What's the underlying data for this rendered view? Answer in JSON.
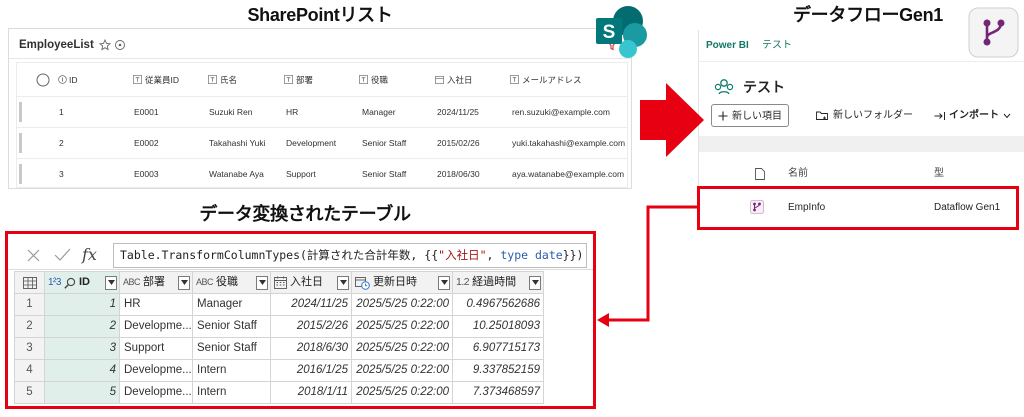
{
  "titles": {
    "sharepoint": "SharePointリスト",
    "dataflow": "データフローGen1",
    "transformed": "データ変換されたテーブル"
  },
  "sharepoint": {
    "logo_letter": "S",
    "list_title": "EmployeeList",
    "columns": [
      "ID",
      "従業員ID",
      "氏名",
      "部署",
      "役職",
      "入社日",
      "メールアドレス"
    ],
    "rows": [
      [
        "1",
        "E0001",
        "Suzuki Ren",
        "HR",
        "Manager",
        "2024/11/25",
        "ren.suzuki@example.com"
      ],
      [
        "2",
        "E0002",
        "Takahashi Yuki",
        "Development",
        "Senior Staff",
        "2015/02/26",
        "yuki.takahashi@example.com"
      ],
      [
        "3",
        "E0003",
        "Watanabe Aya",
        "Support",
        "Senior Staff",
        "2018/06/30",
        "aya.watanabe@example.com"
      ]
    ]
  },
  "dataflow": {
    "app_name": "Power BI",
    "workspace_crumb": "テスト",
    "workspace_title": "テスト",
    "buttons": {
      "new_item": "新しい項目",
      "new_folder": "新しいフォルダー",
      "import": "インポート"
    },
    "columns": {
      "name": "名前",
      "type": "型"
    },
    "row": {
      "name": "EmpInfo",
      "type": "Dataflow Gen1"
    }
  },
  "power_query": {
    "fx_label": "fx",
    "formula": {
      "prefix": "Table.TransformColumnTypes(計算された合計年数, {{",
      "string": "\"入社日\"",
      "sep": ", ",
      "keyword": "type date",
      "suffix": "}})"
    },
    "columns": [
      {
        "type_label": "1²3",
        "name": "ID"
      },
      {
        "type_label": "ABC",
        "name": "部署"
      },
      {
        "type_label": "ABC",
        "name": "役職"
      },
      {
        "name": "入社日"
      },
      {
        "name": "更新日時"
      },
      {
        "type_label": "1.2",
        "name": "経過時間"
      }
    ],
    "rows": [
      {
        "n": "1",
        "id": "1",
        "dept": "HR",
        "role": "Manager",
        "hire": "2024/11/25",
        "updated": "2025/5/25 0:22:00",
        "elapsed": "0.4967562686"
      },
      {
        "n": "2",
        "id": "2",
        "dept": "Developme...",
        "role": "Senior Staff",
        "hire": "2015/2/26",
        "updated": "2025/5/25 0:22:00",
        "elapsed": "10.25018093"
      },
      {
        "n": "3",
        "id": "3",
        "dept": "Support",
        "role": "Senior Staff",
        "hire": "2018/6/30",
        "updated": "2025/5/25 0:22:00",
        "elapsed": "6.907715173"
      },
      {
        "n": "4",
        "id": "4",
        "dept": "Developme...",
        "role": "Intern",
        "hire": "2016/1/25",
        "updated": "2025/5/25 0:22:00",
        "elapsed": "9.337852159"
      },
      {
        "n": "5",
        "id": "5",
        "dept": "Developme...",
        "role": "Intern",
        "hire": "2018/1/11",
        "updated": "2025/5/25 0:22:00",
        "elapsed": "7.373468597"
      }
    ]
  },
  "colors": {
    "highlight_red": "#e60012",
    "powerbi_teal": "#117865",
    "sharepoint_teal": "#03787c",
    "dataflow_purple": "#742774",
    "formula_string": "#a31515",
    "formula_keyword": "#2a5db0",
    "id_column_tint": "#e0efe9"
  },
  "icons": [
    "sharepoint-logo-icon",
    "dataflow-gen1-icon",
    "star-icon",
    "info-circle-icon",
    "filter-icon",
    "select-all-circle-icon",
    "workspace-icon",
    "plus-icon",
    "folder-add-icon",
    "import-icon",
    "chevron-down-icon",
    "document-icon",
    "dataflow-icon",
    "close-icon",
    "check-icon",
    "table-icon",
    "key-search-icon",
    "calendar-icon",
    "datetime-icon",
    "dropdown-arrow-icon"
  ]
}
